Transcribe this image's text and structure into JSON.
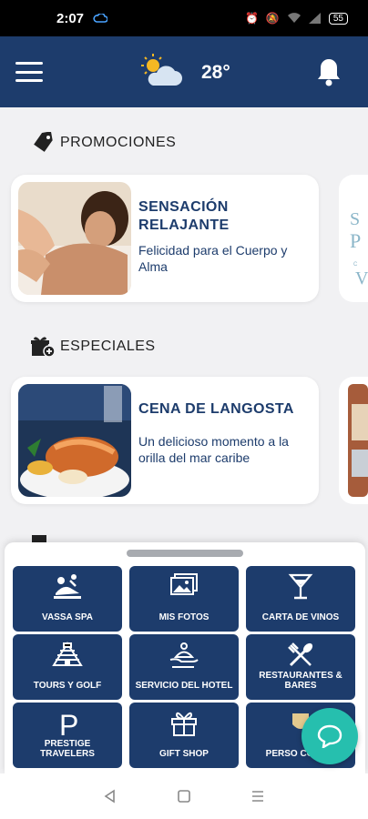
{
  "status_bar": {
    "time": "2:07",
    "battery": "55"
  },
  "header": {
    "temperature": "28°",
    "weather_icon": "partly-sunny-icon"
  },
  "sections": {
    "promociones": {
      "title": "PROMOCIONES",
      "icon": "tag-icon"
    },
    "especiales": {
      "title": "ESPECIALES",
      "icon": "gift-add-icon"
    }
  },
  "promo_card": {
    "title": "SENSACIÓN RELAJANTE",
    "subtitle": "Felicidad para el Cuerpo y Alma"
  },
  "special_card": {
    "title": "CENA DE LANGOSTA",
    "subtitle": "Un delicioso momento a la orilla del mar caribe"
  },
  "menu_tiles": [
    {
      "label": "VASSA SPA",
      "icon": "massage-icon"
    },
    {
      "label": "MIS FOTOS",
      "icon": "photos-icon"
    },
    {
      "label": "CARTA DE VINOS",
      "icon": "wine-glass-icon"
    },
    {
      "label": "TOURS Y GOLF",
      "icon": "pyramid-icon"
    },
    {
      "label": "SERVICIO DEL HOTEL",
      "icon": "room-service-icon"
    },
    {
      "label": "RESTAURANTES & BARES",
      "icon": "utensils-icon"
    },
    {
      "label": "PRESTIGE TRAVELERS",
      "icon": "letter-p-icon"
    },
    {
      "label": "GIFT SHOP",
      "icon": "gift-icon"
    },
    {
      "label": "PERSO CONCIE",
      "icon": "concierge-icon"
    }
  ],
  "colors": {
    "primary": "#1d3c6c",
    "fab": "#26bfae",
    "background": "#f1f1f3"
  }
}
